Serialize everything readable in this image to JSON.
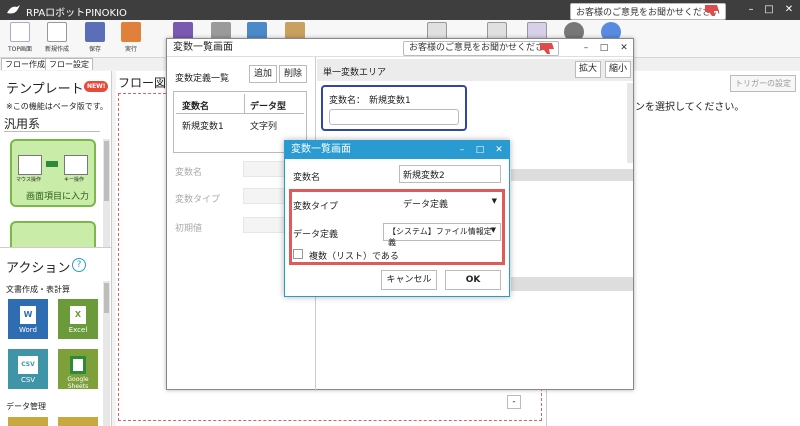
{
  "app": {
    "title": "RPAロボットPINOKIO",
    "feedback": "お客様のご意見をお聞かせください",
    "controls": {
      "minimize": "–",
      "maximize": "□",
      "close": "✕"
    }
  },
  "ribbon": {
    "items": [
      {
        "label": "TOP画面"
      },
      {
        "label": "新規作成"
      },
      {
        "label": "保存"
      },
      {
        "label": "実行"
      }
    ]
  },
  "tabs": [
    "フロー作成",
    "フロー設定"
  ],
  "left_panel": {
    "template_heading": "テンプレート",
    "new_badge": "NEW!",
    "beta_note": "※この機能はベータ版です。",
    "category": "汎用系",
    "card1": {
      "left_label": "マウス操作",
      "right_label": "キー操作",
      "caption": "画面項目に入力"
    },
    "actions_heading": "アクション",
    "help": "?",
    "actions_category": "文書作成・表計算",
    "apps": [
      {
        "name": "Word",
        "glyph": "W",
        "color": "#2f6db2"
      },
      {
        "name": "Excel",
        "glyph": "X",
        "color": "#6a9a3a"
      },
      {
        "name": "CSV",
        "glyph": "CSV",
        "color": "#3f94a8"
      },
      {
        "name": "Google Sheets",
        "glyph": "",
        "color": "#7ea03a"
      }
    ],
    "data_mgmt": "データ管理"
  },
  "flow": {
    "heading": "フロー図"
  },
  "right_panel": {
    "trigger_button": "トリガーの設定",
    "instruction": "ンを選択してください。"
  },
  "dialog1": {
    "title": "変数一覧画面",
    "feedback": "お客様のご意見をお聞かせください",
    "list_heading": "変数定義一覧",
    "add_button": "追加",
    "delete_button": "削除",
    "columns": [
      "変数名",
      "データ型"
    ],
    "rows": [
      [
        "新規変数1",
        "文字列"
      ]
    ],
    "field_name": "変数名",
    "field_type": "変数タイプ",
    "field_initial": "初期値",
    "single_area": "単一変数エリア",
    "expand_button": "拡大",
    "shrink_button": "縮小",
    "var_label": "変数名：",
    "var_value": "新規変数1",
    "collapse_glyph": "-"
  },
  "dialog2": {
    "title": "変数一覧画面",
    "name_label": "変数名",
    "name_value": "新規変数2",
    "type_label": "変数タイプ",
    "type_value": "データ定義",
    "def_label": "データ定義",
    "def_value": "【システム】ファイル情報定義",
    "multiple_label": "複数（リスト）である",
    "cancel_button": "キャンセル",
    "ok_button": "OK"
  },
  "colors": {
    "accent_blue": "#2a9bd1",
    "highlight_red": "#e05a5a",
    "selected_border": "#3344aa",
    "template_green": "#7ab84a"
  }
}
